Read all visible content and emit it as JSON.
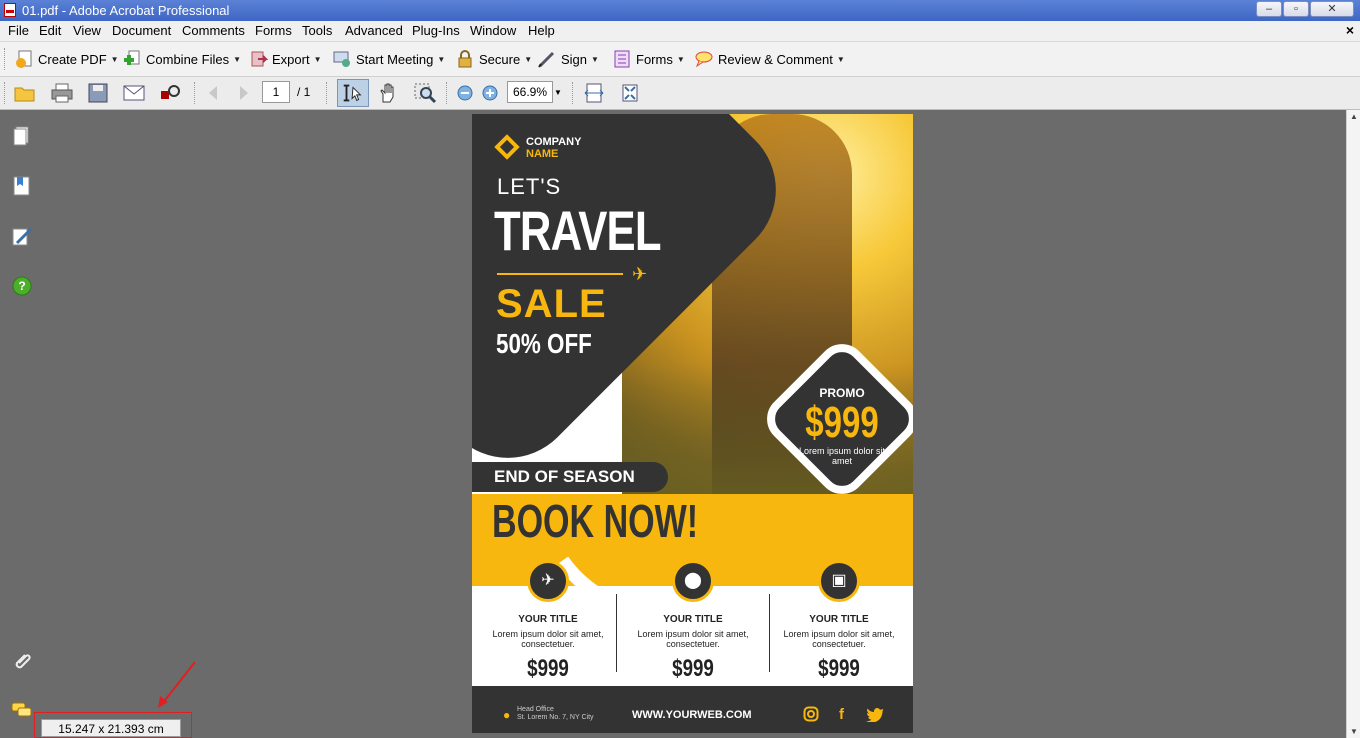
{
  "window": {
    "title": "01.pdf - Adobe Acrobat Professional",
    "min": "‒",
    "restore": "▫",
    "close": "✕"
  },
  "menu": [
    "File",
    "Edit",
    "View",
    "Document",
    "Comments",
    "Forms",
    "Tools",
    "Advanced",
    "Plug-Ins",
    "Window",
    "Help"
  ],
  "menu_close": "×",
  "toolbar": {
    "create_pdf": "Create PDF",
    "combine_files": "Combine Files",
    "export": "Export",
    "start_meeting": "Start Meeting",
    "secure": "Secure",
    "sign": "Sign",
    "forms": "Forms",
    "review_comment": "Review & Comment"
  },
  "nav": {
    "page_value": "1",
    "page_total": "/ 1",
    "zoom_value": "66.9%"
  },
  "page_size": "15.247 x 21.393 cm",
  "poster": {
    "company_line1": "COMPANY",
    "company_line2": "NAME",
    "lets": "LET'S",
    "travel": "TRAVEL",
    "sale": "SALE",
    "off": "50% OFF",
    "promo_label": "PROMO",
    "promo_price": "$999",
    "promo_desc": "Lorem ipsum dolor sit amet",
    "end_of_season": "END OF SEASON",
    "book_now": "BOOK NOW!",
    "features": [
      {
        "title": "YOUR TITLE",
        "desc": "Lorem ipsum dolor sit amet, consectetuer.",
        "price": "$999"
      },
      {
        "title": "YOUR TITLE",
        "desc": "Lorem ipsum dolor sit amet, consectetuer.",
        "price": "$999"
      },
      {
        "title": "YOUR TITLE",
        "desc": "Lorem ipsum dolor sit amet, consectetuer.",
        "price": "$999"
      }
    ],
    "office_label": "Head Office",
    "office_address": "St. Lorem No. 7, NY City",
    "website": "WWW.YOURWEB.COM",
    "social": {
      "facebook": "f"
    }
  },
  "colors": {
    "accent_yellow": "#f8b70e",
    "poster_dark": "#333333",
    "titlebar": "#4a72cc",
    "canvas": "#6b6b6b"
  },
  "icons": [
    "pdf-doc-icon",
    "create-pdf-icon",
    "combine-files-icon",
    "export-icon",
    "start-meeting-icon",
    "secure-lock-icon",
    "sign-pen-icon",
    "forms-icon",
    "review-comment-icon",
    "open-folder-icon",
    "print-icon",
    "save-icon",
    "email-icon",
    "find-icon",
    "previous-page-icon",
    "next-page-icon",
    "select-tool-icon",
    "hand-tool-icon",
    "zoom-tool-icon",
    "zoom-out-icon",
    "zoom-in-icon",
    "fit-width-icon",
    "fit-page-icon",
    "pages-icon",
    "bookmarks-icon",
    "signatures-icon",
    "help-icon",
    "attachments-icon",
    "comments-icon",
    "instagram-icon",
    "facebook-icon",
    "twitter-icon",
    "plane-icon",
    "location-pin-icon",
    "camera-icon"
  ]
}
